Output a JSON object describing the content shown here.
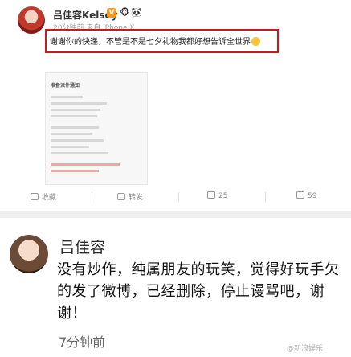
{
  "post": {
    "author": "吕佳容Kelsey",
    "verified_badge": "V",
    "badge_emojis": [
      "🐵",
      "🐼"
    ],
    "meta": "20分钟前 来自 iPhone X",
    "text": "谢谢你的快递，不管是不是七夕礼物我都好想告诉全世界",
    "screenshot": {
      "title": "准备派件通知"
    },
    "actions": {
      "collect_label": "收藏",
      "repost_label": "转发",
      "comment_count": "25",
      "like_count": "59"
    }
  },
  "comment_post": {
    "author": "吕佳容",
    "text": "没有炒作，纯属朋友的玩笑，觉得好玩手欠的发了微博，已经删除，停止谩骂吧，谢谢！",
    "time": "7分钟前",
    "watermark": "@新浪娱乐"
  },
  "colors": {
    "highlight_border": "#c9191c",
    "vip_badge": "#f49b1c"
  }
}
